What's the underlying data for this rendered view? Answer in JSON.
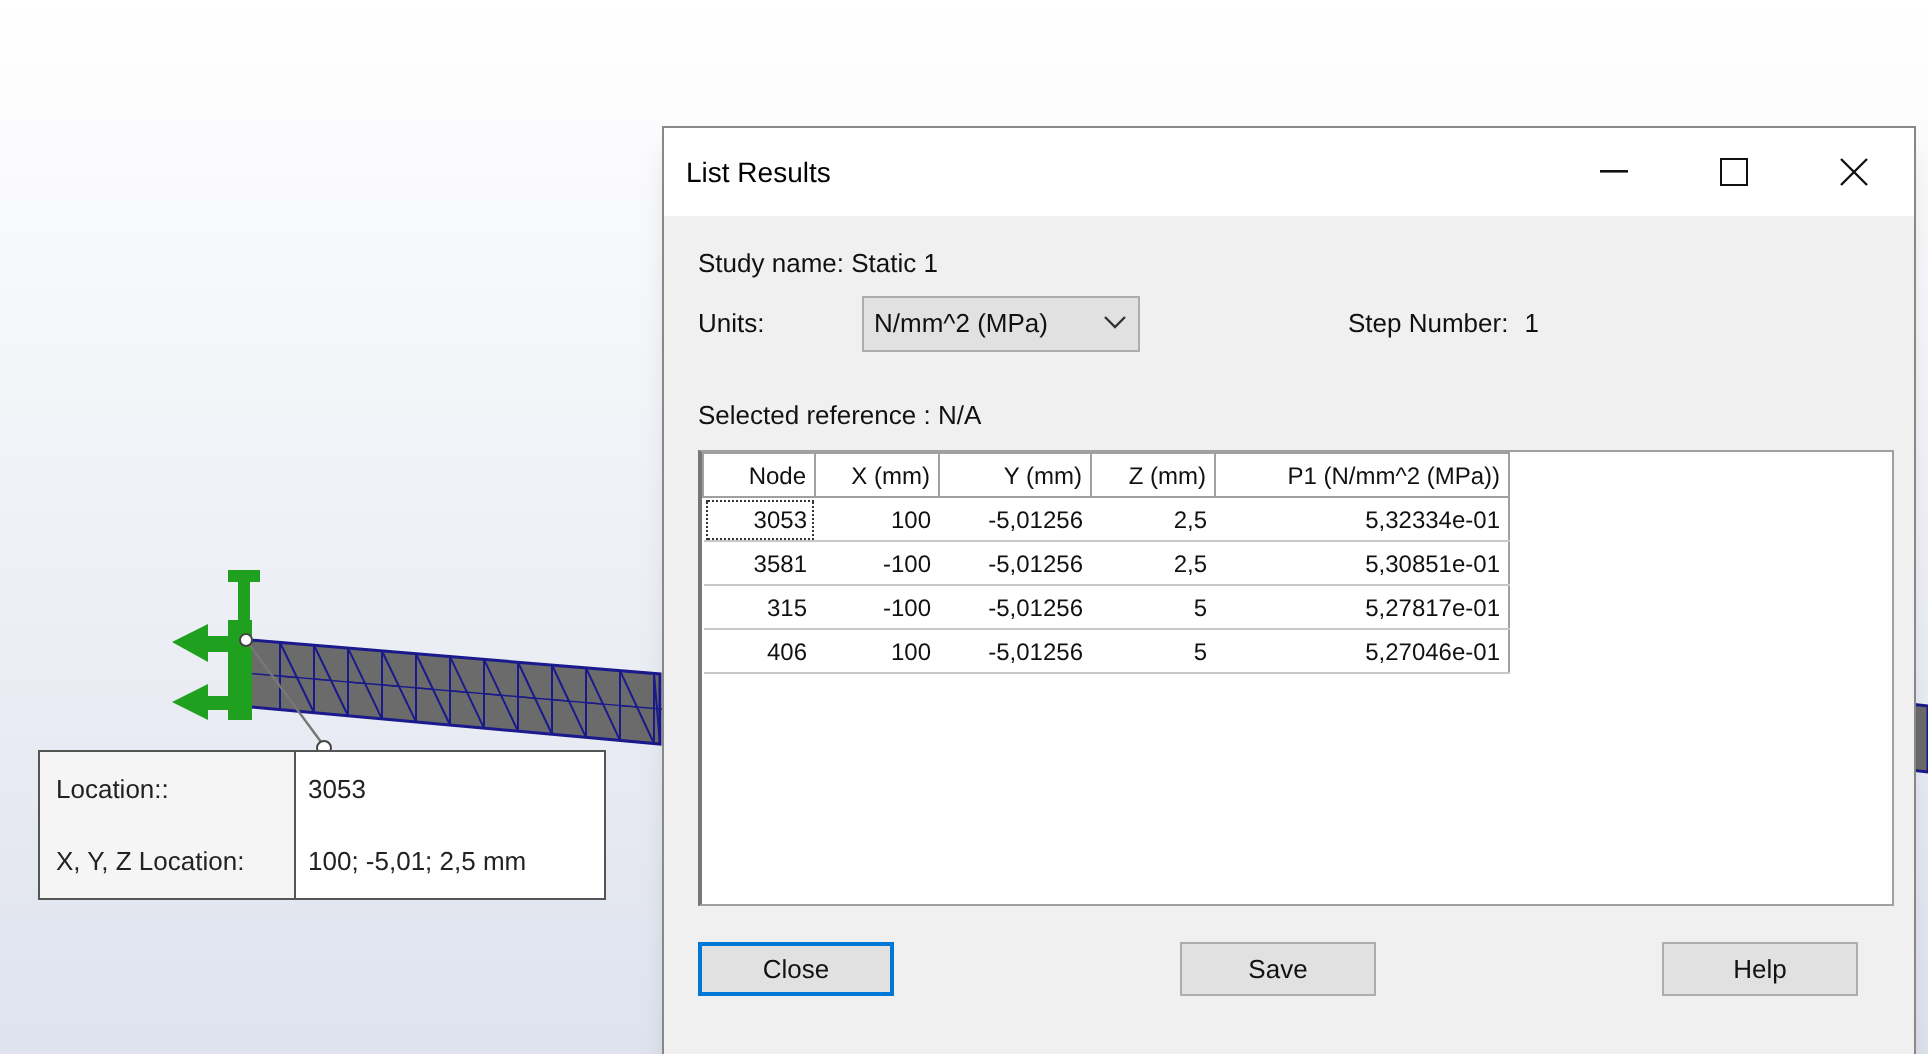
{
  "viewport": {
    "tooltip": [
      {
        "label": "Location::",
        "value": "3053"
      },
      {
        "label": "X, Y, Z Location:",
        "value": "100; -5,01; 2,5 mm"
      }
    ]
  },
  "dialog": {
    "title": "List Results",
    "study_name": "Study name: Static 1",
    "units_label": "Units:",
    "units": "N/mm^2 (MPa)",
    "step_label": "Step Number:",
    "step_value": "1",
    "selected_reference": "Selected reference : N/A",
    "table": {
      "columns": [
        "Node",
        "X (mm)",
        "Y (mm)",
        "Z (mm)",
        "P1 (N/mm^2 (MPa))"
      ],
      "rows": [
        {
          "cells": [
            "3053",
            "100",
            "-5,01256",
            "2,5",
            "5,32334e-01"
          ],
          "focused": true
        },
        {
          "cells": [
            "3581",
            "-100",
            "-5,01256",
            "2,5",
            "5,30851e-01"
          ],
          "focused": false
        },
        {
          "cells": [
            "315",
            "-100",
            "-5,01256",
            "5",
            "5,27817e-01"
          ],
          "focused": false
        },
        {
          "cells": [
            "406",
            "100",
            "-5,01256",
            "5",
            "5,27046e-01"
          ],
          "focused": false
        }
      ]
    },
    "buttons": [
      {
        "label": "Close",
        "default": true
      },
      {
        "label": "Save",
        "default": false
      },
      {
        "label": "Help",
        "default": false
      }
    ]
  }
}
